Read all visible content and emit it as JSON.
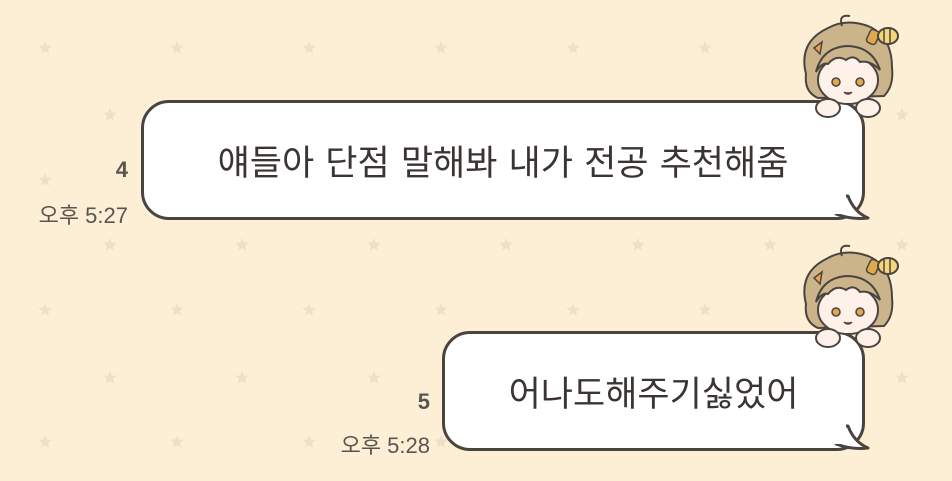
{
  "colors": {
    "background": "#fcefd6",
    "star": "#efdfc6",
    "bubble_fill": "#ffffff",
    "bubble_border": "#4a4440",
    "text": "#3a3532",
    "meta_text": "#5b5550"
  },
  "messages": [
    {
      "text": "얘들아 단점 말해봐 내가 전공 추천해줌",
      "unread_count": "4",
      "time": "오후 5:27",
      "sticker": "chibi-character-icon"
    },
    {
      "text": "어나도해주기싫었어",
      "unread_count": "5",
      "time": "오후 5:28",
      "sticker": "chibi-character-icon"
    }
  ]
}
